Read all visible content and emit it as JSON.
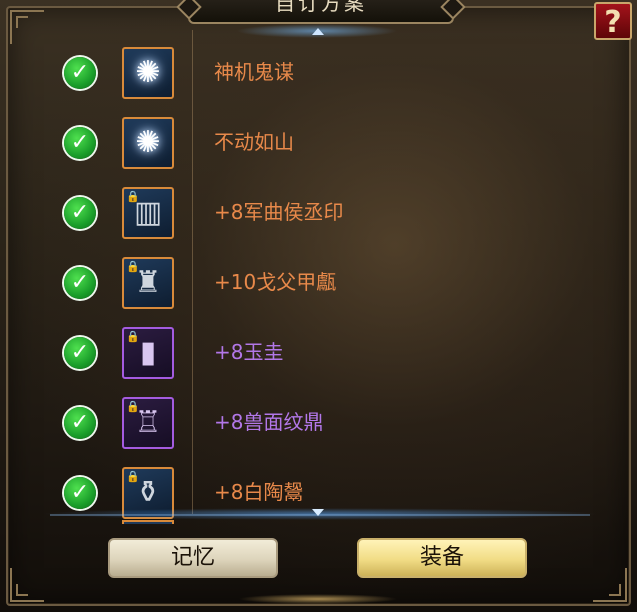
{
  "window": {
    "title": "自订方案",
    "help_label": "?"
  },
  "list": {
    "items": [
      {
        "name": "神机鬼谋",
        "icon": "lightning-orb-icon",
        "locked": false,
        "quality": "orange",
        "checked": true
      },
      {
        "name": "不动如山",
        "icon": "lightning-orb-icon",
        "locked": false,
        "quality": "orange",
        "checked": true
      },
      {
        "name": "+8军曲侯丞印",
        "icon": "seal-icon",
        "locked": true,
        "quality": "orange",
        "checked": true
      },
      {
        "name": "+10戈父甲甗",
        "icon": "bronze-vessel-icon",
        "locked": true,
        "quality": "orange",
        "checked": true
      },
      {
        "name": "+8玉圭",
        "icon": "jade-tablet-icon",
        "locked": true,
        "quality": "purple",
        "checked": true
      },
      {
        "name": "+8兽面纹鼎",
        "icon": "bronze-ding-icon",
        "locked": true,
        "quality": "purple",
        "checked": true
      },
      {
        "name": "+8白陶鬶",
        "icon": "white-pottery-icon",
        "locked": true,
        "quality": "orange",
        "checked": true
      }
    ]
  },
  "buttons": {
    "memory_label": "记忆",
    "equip_label": "装备"
  },
  "colors": {
    "orange_text": "#e8894a",
    "purple_text": "#b277e8",
    "check_green": "#1a9e2a"
  }
}
